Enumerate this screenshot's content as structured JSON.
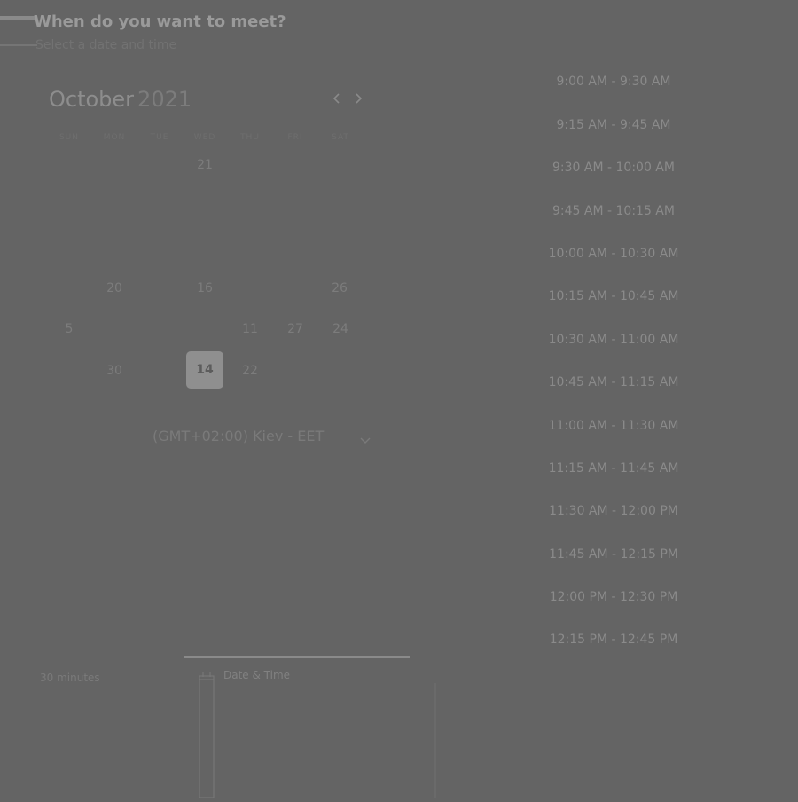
{
  "header": {
    "title": "When do you want to meet?",
    "subtitle": "Select a date and time"
  },
  "calendar": {
    "month": "October",
    "year": "2021",
    "weekdays": [
      "SUN",
      "MON",
      "TUE",
      "WED",
      "THU",
      "FRI",
      "SAT"
    ],
    "days": [
      {
        "label": "21",
        "selected": false
      },
      {
        "label": "20",
        "selected": false
      },
      {
        "label": "16",
        "selected": false
      },
      {
        "label": "26",
        "selected": false
      },
      {
        "label": "5",
        "selected": false
      },
      {
        "label": "11",
        "selected": false
      },
      {
        "label": "27",
        "selected": false
      },
      {
        "label": "24",
        "selected": false
      },
      {
        "label": "30",
        "selected": false
      },
      {
        "label": "14",
        "selected": true
      },
      {
        "label": "22",
        "selected": false
      }
    ],
    "prev_icon": "chevron-left-icon",
    "next_icon": "chevron-right-icon"
  },
  "timezone": {
    "label": "(GMT+02:00) Kiev - EET",
    "icon": "chevron-down-icon"
  },
  "time_slots": [
    "9:00 AM - 9:30 AM",
    "9:15 AM - 9:45 AM",
    "9:30 AM - 10:00 AM",
    "9:45 AM - 10:15 AM",
    "10:00 AM - 10:30 AM",
    "10:15 AM - 10:45 AM",
    "10:30 AM - 11:00 AM",
    "10:45 AM - 11:15 AM",
    "11:00 AM - 11:30 AM",
    "11:15 AM - 11:45 AM",
    "11:30 AM - 12:00 PM",
    "11:45 AM - 12:15 PM",
    "12:00 PM - 12:30 PM",
    "12:15 PM - 12:45 PM"
  ],
  "footer": {
    "duration": "30 minutes",
    "date_time_label": "Date & Time",
    "date_time_icon": "calendar-icon"
  }
}
